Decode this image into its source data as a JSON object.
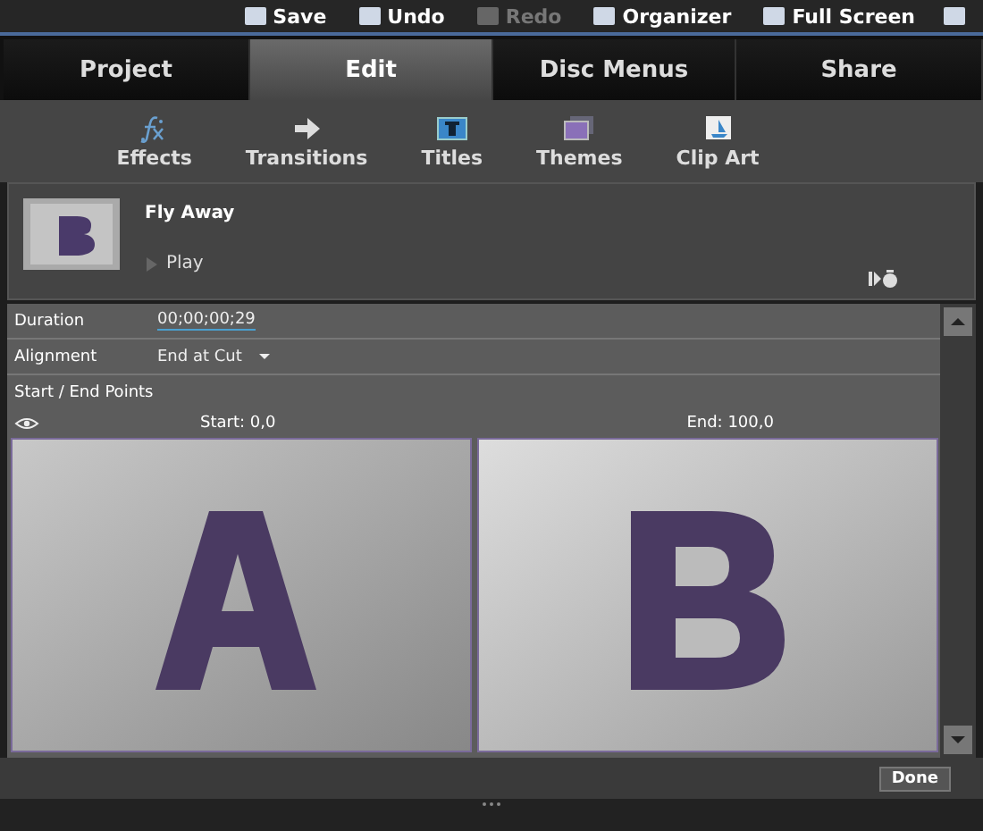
{
  "toolbar": [
    {
      "label": "Save",
      "disabled": false
    },
    {
      "label": "Undo",
      "disabled": false
    },
    {
      "label": "Redo",
      "disabled": true
    },
    {
      "label": "Organizer",
      "disabled": false
    },
    {
      "label": "Full Screen",
      "disabled": false
    }
  ],
  "tabs": [
    {
      "label": "Project",
      "selected": false
    },
    {
      "label": "Edit",
      "selected": true
    },
    {
      "label": "Disc Menus",
      "selected": false
    },
    {
      "label": "Share",
      "selected": false
    }
  ],
  "tools": [
    {
      "label": "Effects",
      "kind": "fx"
    },
    {
      "label": "Transitions",
      "kind": "arrow"
    },
    {
      "label": "Titles",
      "kind": "title"
    },
    {
      "label": "Themes",
      "kind": "themes"
    },
    {
      "label": "Clip Art",
      "kind": "clipart"
    }
  ],
  "effect": {
    "name": "Fly Away",
    "play": "Play"
  },
  "properties": {
    "duration": {
      "label": "Duration",
      "value": "00;00;00;29"
    },
    "alignment": {
      "label": "Alignment",
      "value": "End at Cut"
    },
    "points": {
      "title": "Start / End Points",
      "start_label": "Start:",
      "start_value": "0,0",
      "end_label": "End:",
      "end_value": "100,0"
    }
  },
  "done": "Done"
}
